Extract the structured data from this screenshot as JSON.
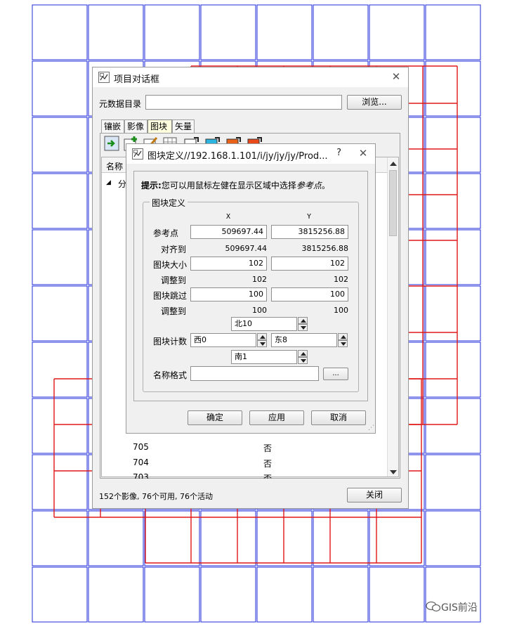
{
  "background": {
    "blue": "#1f2ad8",
    "red": "#e01818"
  },
  "project_dialog": {
    "title": "项目对话框",
    "close_glyph": "✕",
    "metadata_label": "元数据目录",
    "metadata_value": "",
    "browse_label": "浏览...",
    "tabs": [
      {
        "label": "镶嵌",
        "active": false
      },
      {
        "label": "影像",
        "active": false
      },
      {
        "label": "图块",
        "active": true
      },
      {
        "label": "矢量",
        "active": false
      }
    ],
    "list_header": "名称",
    "tree_node": "分",
    "rows": [
      {
        "name": "705",
        "flag": "否"
      },
      {
        "name": "704",
        "flag": "否"
      },
      {
        "name": "703",
        "flag": "否"
      }
    ],
    "status": "152个影像, 76个可用, 76个活动",
    "close_label": "关闭"
  },
  "tile_dialog": {
    "title": "图块定义//192.168.1.101/i/jy/jy/jy/Prod...",
    "help_glyph": "?",
    "close_glyph": "✕",
    "hint_bold": "提示:",
    "hint_text": "您可以用鼠标左健在显示区域中选择",
    "hint_italic": "参考点",
    "hint_end": "。",
    "group_label": "图块定义",
    "col_x": "X",
    "col_y": "Y",
    "ref_label": "参考点",
    "ref_x": "509697.44",
    "ref_y": "3815256.88",
    "align_label": "对齐到",
    "align_x": "509697.44",
    "align_y": "3815256.88",
    "size_label": "图块大小",
    "size_x": "102",
    "size_y": "102",
    "size_adj_label": "调整到",
    "size_adj_x": "102",
    "size_adj_y": "102",
    "skip_label": "图块跳过",
    "skip_x": "100",
    "skip_y": "100",
    "skip_adj_label": "调整到",
    "skip_adj_x": "100",
    "skip_adj_y": "100",
    "north": "北10",
    "count_label": "图块计数",
    "west": "西0",
    "east": "东8",
    "south": "南1",
    "name_format_label": "名称格式",
    "name_format_value": "",
    "ellipsis": "...",
    "ok_label": "确定",
    "apply_label": "应用",
    "cancel_label": "取消"
  },
  "watermark": "GIS前沿"
}
